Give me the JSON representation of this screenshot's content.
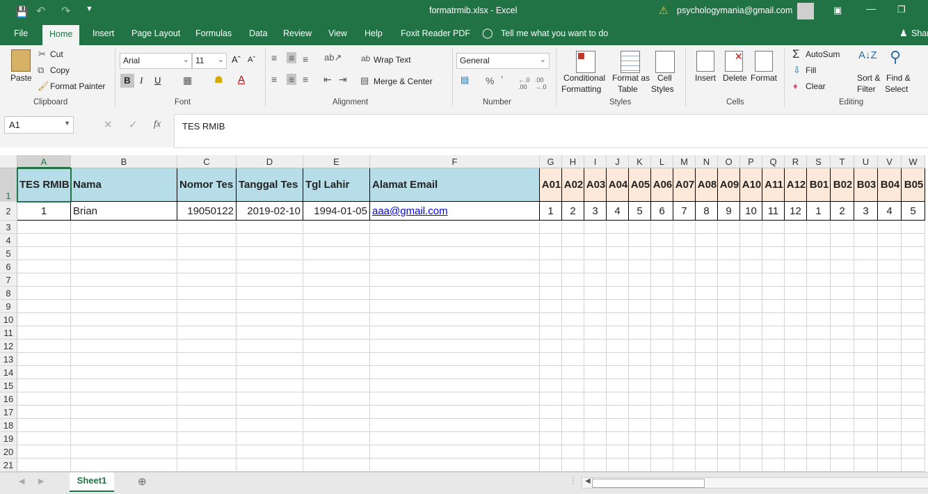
{
  "titlebar": {
    "title": "formatrmib.xlsx  -  Excel",
    "account": "psychologymania@gmail.com"
  },
  "tabs": [
    "File",
    "Home",
    "Insert",
    "Page Layout",
    "Formulas",
    "Data",
    "Review",
    "View",
    "Help",
    "Foxit Reader PDF"
  ],
  "tell_me": "Tell me what you want to do",
  "share": "Share",
  "ribbon": {
    "clipboard": {
      "paste": "Paste",
      "cut": "Cut",
      "copy": "Copy",
      "format_painter": "Format Painter",
      "label": "Clipboard"
    },
    "font": {
      "name": "Arial",
      "size": "11",
      "label": "Font"
    },
    "alignment": {
      "wrap": "Wrap Text",
      "merge": "Merge & Center",
      "label": "Alignment"
    },
    "number": {
      "format": "General",
      "label": "Number"
    },
    "styles": {
      "cond1": "Conditional",
      "cond2": "Formatting",
      "fmt1": "Format as",
      "fmt2": "Table",
      "cell1": "Cell",
      "cell2": "Styles",
      "label": "Styles"
    },
    "cells": {
      "insert": "Insert",
      "delete": "Delete",
      "format": "Format",
      "label": "Cells"
    },
    "editing": {
      "autosum": "AutoSum",
      "fill": "Fill",
      "clear": "Clear",
      "sort1": "Sort &",
      "sort2": "Filter",
      "find1": "Find &",
      "find2": "Select",
      "label": "Editing"
    }
  },
  "formula_bar": {
    "name_box": "A1",
    "fx": "fx",
    "content": "TES RMIB"
  },
  "columns": [
    "A",
    "B",
    "C",
    "D",
    "E",
    "F",
    "G",
    "H",
    "I",
    "J",
    "K",
    "L",
    "M",
    "N",
    "O",
    "P",
    "Q",
    "R",
    "S",
    "T",
    "U",
    "V",
    "W"
  ],
  "rows": [
    "1",
    "2",
    "3",
    "4",
    "5",
    "6",
    "7",
    "8",
    "9",
    "10",
    "11",
    "12",
    "13",
    "14",
    "15",
    "16",
    "17",
    "18",
    "19",
    "20",
    "21"
  ],
  "header_row": [
    "TES RMIB",
    "Nama",
    "Nomor Tes",
    "Tanggal Tes",
    "Tgl Lahir",
    "Alamat Email",
    "A01",
    "A02",
    "A03",
    "A04",
    "A05",
    "A06",
    "A07",
    "A08",
    "A09",
    "A10",
    "A11",
    "A12",
    "B01",
    "B02",
    "B03",
    "B04",
    "B05"
  ],
  "data_row": [
    "1",
    "Brian",
    "19050122",
    "2019-02-10",
    "1994-01-05",
    "aaa@gmail.com",
    "1",
    "2",
    "3",
    "4",
    "5",
    "6",
    "7",
    "8",
    "9",
    "10",
    "11",
    "12",
    "1",
    "2",
    "3",
    "4",
    "5"
  ],
  "sheet_tab": "Sheet1",
  "colors": {
    "excel_green": "#217346",
    "header_blue": "#b7dde8",
    "header_peach": "#fde9d9"
  }
}
